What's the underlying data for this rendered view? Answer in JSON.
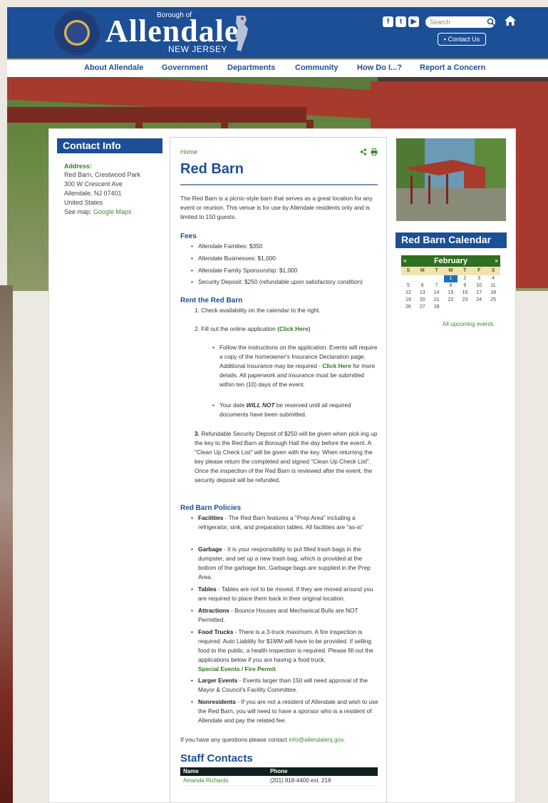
{
  "header": {
    "logo_small": "Borough of",
    "logo_big": "Allendale",
    "logo_state": "NEW JERSEY",
    "search_placeholder": "Search",
    "contact_button": "Contact Us",
    "social": [
      {
        "icon": "facebook-icon",
        "glyph": "f"
      },
      {
        "icon": "twitter-icon",
        "glyph": "t"
      },
      {
        "icon": "youtube-icon",
        "glyph": "▶"
      }
    ]
  },
  "nav": {
    "items": [
      "About Allendale",
      "Government",
      "Departments",
      "Community",
      "How Do I...?",
      "Report a Concern"
    ]
  },
  "contact_info": {
    "heading": "Contact Info",
    "address_label": "Address:",
    "lines": [
      "Red Barn, Crestwood Park",
      "300 W Crescent Ave",
      "Allendale, NJ 07401",
      "United States"
    ],
    "see_map": "See map: ",
    "map_link": "Google Maps"
  },
  "main": {
    "breadcrumb": "Home",
    "title": "Red Barn",
    "intro": "The Red Barn is a picnic-style barn that serves as a great location for any event or reunion. This venue is for use by Allendale residents only and is limited to 150 guests.",
    "fees_heading": "Fees",
    "fees": [
      "Allendale Families: $350",
      "Allendale Businesses: $1,000",
      "Allendale Family Sponsorship: $1,000",
      "Security Deposit: $250 (refundable upon satisfactory condition)"
    ],
    "rent_heading": "Rent the Red Barn",
    "step1": "1. Check availability on the calendar to the right.",
    "step2_prefix": "2. Fill out the online application ",
    "step2_link": "(Click Here)",
    "sub1_a": "Follow the instructions on the application. Events will require a copy of the homeowner's Insurance Declaration page.  Additional insurance may be required - ",
    "sub1_link": "Click Here",
    "sub1_b": " for more details. All paperwork and insurance must be submitted within ten (10) days of the event.",
    "sub2_a": "Your date ",
    "sub2_bold": "WILL NOT",
    "sub2_b": " be reserved until all required documents have been submitted.",
    "step3_num": "3.",
    "step3": " Refundable Security Deposit of $250 will be given when pick-ing up the key to the Red Barn at Borough Hall the day before the event. A \"Clean Up Check List\" will be given with the key.  When returning the key please return the completed and signed \"Clean Up Check List\".  Once the inspection of the Red Barn is reviewed after the event, the security deposit will be refunded.",
    "policies_heading": "Red Barn Policies",
    "policies": [
      {
        "title": "Facilities",
        "text": " - The Red Barn features a \"Prep Area\" including a refrigerator, sink, and preparation tables. All facilities are \"as-is\""
      },
      {
        "title": "Garbage",
        "text": " - It is your responsibility to put filled trash bags in the dumpster, and set up a new trash bag, which is provided at the bottom of the garbage bin. Garbage bags are supplied in the Prep Area."
      },
      {
        "title": "Tables",
        "text": " - Tables are not to be moved. If they are moved around you are required to place them back in their original location."
      },
      {
        "title": "Attractions",
        "text": " - Bounce Houses and Mechanical Bulls are NOT Permitted."
      },
      {
        "title": "Food Trucks",
        "text": " - There is a 3-truck maximum. A fire inspection is required. Auto Liability for $1MM will have to be provided. If selling food to the public, a health inspection is required. Please fill out the applications below if you are having a food truck."
      },
      {
        "title": "Larger Events",
        "text": " - Events larger than 150 will need approval of the Mayor & Council's Facility Committee."
      },
      {
        "title": "Nonresidents",
        "text": " - If you are not a resident of Allendale and wish to use the Red Barn, you will need to have a sponsor who is a resident of Allendale and pay the related fee."
      }
    ],
    "food_truck_link": "Special Events / Fire Permit",
    "questions_prefix": "If you have any questions please contact ",
    "questions_email": "info@allendalenj.gov",
    "questions_suffix": ".",
    "staff_heading": "Staff Contacts",
    "staff_columns": [
      "Name",
      "Phone"
    ],
    "staff_rows": [
      {
        "name": "Amanda Richards",
        "phone": "(201) 818-4400 ext. 218"
      }
    ]
  },
  "calendar": {
    "heading": "Red Barn Calendar",
    "month": "February",
    "prev": "«",
    "next": "»",
    "dow": [
      "S",
      "M",
      "T",
      "W",
      "T",
      "F",
      "S"
    ],
    "weeks": [
      [
        "",
        "",
        "",
        "1",
        "2",
        "3",
        "4"
      ],
      [
        "5",
        "6",
        "7",
        "8",
        "9",
        "10",
        "11"
      ],
      [
        "12",
        "13",
        "14",
        "15",
        "16",
        "17",
        "18"
      ],
      [
        "19",
        "20",
        "21",
        "22",
        "23",
        "24",
        "25"
      ],
      [
        "26",
        "27",
        "28",
        "",
        "",
        "",
        ""
      ]
    ],
    "today": "1",
    "all_events": "All upcoming events"
  },
  "colors": {
    "brand_blue": "#1c4f96",
    "link_green": "#3b8a2b",
    "calendar_green": "#2f6f1f"
  }
}
